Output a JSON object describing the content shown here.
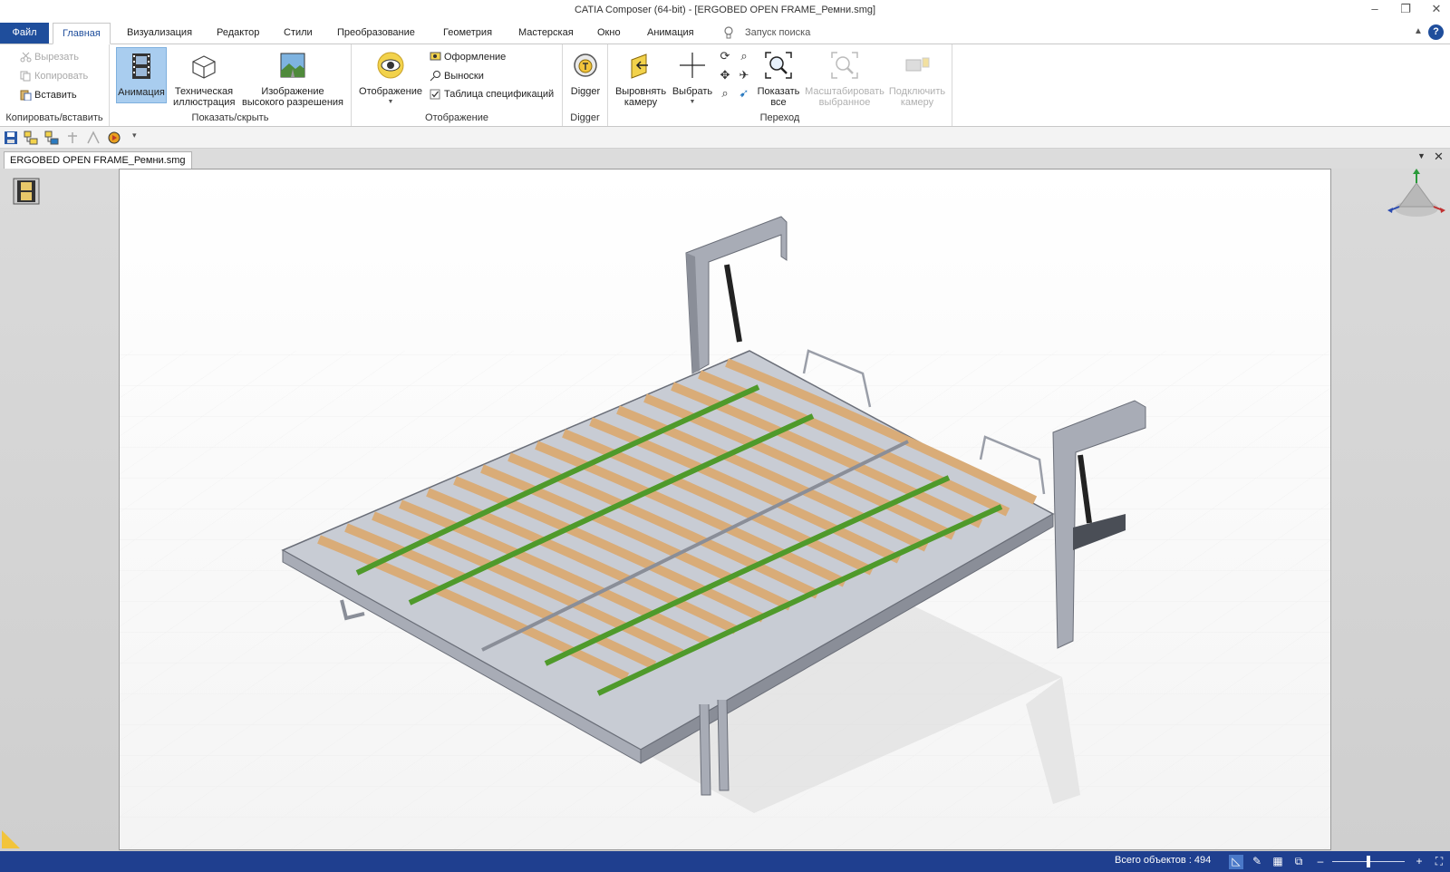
{
  "window": {
    "title": "CATIA Composer (64-bit) - [ERGOBED OPEN FRAME_Ремни.smg]",
    "minimize": "–",
    "restore": "❐",
    "close": "✕"
  },
  "menu": {
    "file": "Файл",
    "tabs": [
      "Главная",
      "Визуализация",
      "Редактор",
      "Стили",
      "Преобразование",
      "Геометрия",
      "Мастерская",
      "Окно",
      "Анимация"
    ],
    "search_label": "Запуск поиска",
    "help": "?"
  },
  "ribbon": {
    "clipboard": {
      "cut": "Вырезать",
      "copy": "Копировать",
      "paste": "Вставить",
      "label": "Копировать/вставить"
    },
    "show_hide": {
      "animation": "Анимация",
      "tech_illustration_1": "Техническая",
      "tech_illustration_2": "иллюстрация",
      "hires_1": "Изображение",
      "hires_2": "высокого разрешения",
      "label": "Показать/скрыть"
    },
    "display": {
      "display_btn": "Отображение",
      "styling": "Оформление",
      "callouts": "Выноски",
      "bom_table": "Таблица спецификаций",
      "bom_checked": true,
      "label": "Отображение"
    },
    "digger": {
      "btn": "Digger",
      "label": "Digger"
    },
    "navigation": {
      "align_1": "Выровнять",
      "align_2": "камеру",
      "select": "Выбрать",
      "show_all_1": "Показать",
      "show_all_2": "все",
      "zoom_sel_1": "Масштабировать",
      "zoom_sel_2": "выбранное",
      "connect_1": "Подключить",
      "connect_2": "камеру",
      "label": "Переход"
    }
  },
  "document": {
    "tab": "ERGOBED OPEN FRAME_Ремни.smg"
  },
  "status": {
    "total_objects": "Всего объектов : 494",
    "zoom_minus": "–",
    "zoom_plus": "+",
    "zoom_level": 0.5
  },
  "colors": {
    "accent": "#1f4e9c",
    "status": "#1f3f8f",
    "active_btn": "#a9cdef",
    "slat_wood": "#d9ac78",
    "strap_green": "#4f9a2b",
    "frame_steel": "#a8acb6"
  }
}
